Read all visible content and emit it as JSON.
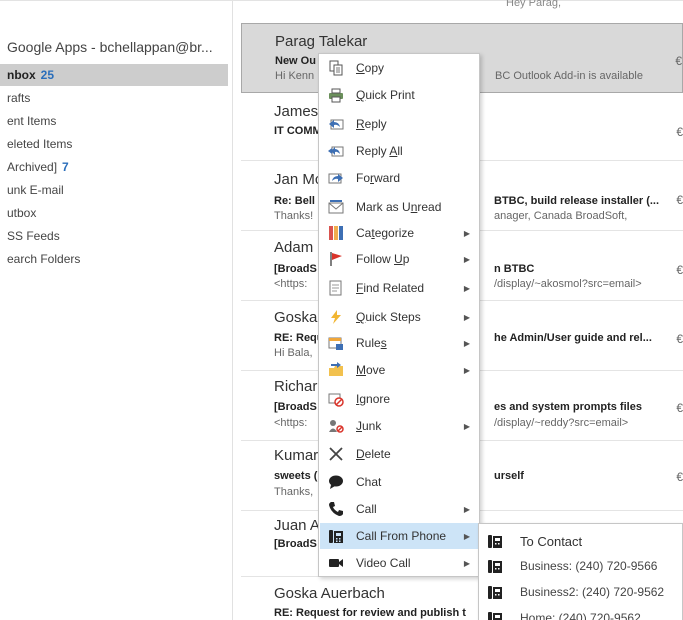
{
  "folders": {
    "account": "Google Apps - bchellappan@br...",
    "items": [
      {
        "label": "nbox",
        "count": "25",
        "selected": true
      },
      {
        "label": "rafts",
        "count": ""
      },
      {
        "label": "ent Items",
        "count": ""
      },
      {
        "label": "eleted Items",
        "count": ""
      },
      {
        "label": "Archived]",
        "count": "7"
      },
      {
        "label": "unk E-mail",
        "count": ""
      },
      {
        "label": "utbox",
        "count": ""
      },
      {
        "label": "SS Feeds",
        "count": ""
      },
      {
        "label": "earch Folders",
        "count": ""
      }
    ]
  },
  "messages": {
    "top_fragment": "Hey Parag,",
    "items": [
      {
        "sender": "Parag Talekar",
        "subject": "New Ou",
        "preview": "Hi Kenn",
        "right_subject": "",
        "right_preview": "BC Outlook Add-in is available",
        "marker": "€"
      },
      {
        "sender": "James",
        "subject": "IT COMM",
        "preview": "",
        "right_subject": "",
        "right_preview": "",
        "marker": "€"
      },
      {
        "sender": "Jan Mc",
        "subject": "Re: Bell",
        "preview": "Thanks!",
        "right_subject": "BTBC, build release installer (...",
        "right_preview": "anager, Canada BroadSoft,",
        "marker": "€"
      },
      {
        "sender": "Adam",
        "subject": "[BroadS",
        "preview": "<https:",
        "right_subject": "n BTBC",
        "right_preview": "/display/~akosmol?src=email>",
        "marker": "€"
      },
      {
        "sender": "Goska",
        "subject": "RE: Requ",
        "preview": "Hi Bala,",
        "right_subject": "he Admin/User guide and rel...",
        "right_preview": "",
        "marker": "€"
      },
      {
        "sender": "Richar",
        "subject": "[BroadS",
        "preview": "<https:",
        "right_subject": "es and system prompts files",
        "right_preview": "/display/~reddy?src=email>",
        "marker": "€"
      },
      {
        "sender": "Kumar",
        "subject": "sweets (",
        "preview": "Thanks,",
        "right_subject": "urself",
        "right_preview": "",
        "marker": "€"
      },
      {
        "sender": "Juan A",
        "subject": "[BroadS",
        "preview": "",
        "right_subject": "",
        "right_preview": "",
        "marker": "€"
      },
      {
        "sender": "Goska Auerbach",
        "subject": "RE: Request for review and publish t",
        "preview": "",
        "right_subject": "",
        "right_preview": "",
        "marker": "€"
      }
    ]
  },
  "context_menu": {
    "items": [
      {
        "pre": "",
        "u": "C",
        "post": "opy",
        "icon": "copy-icon",
        "arrow": ""
      },
      {
        "pre": "",
        "u": "Q",
        "post": "uick Print",
        "icon": "quick-print-icon",
        "arrow": ""
      },
      {
        "pre": "",
        "u": "R",
        "post": "eply",
        "icon": "reply-icon",
        "arrow": ""
      },
      {
        "pre": "Reply ",
        "u": "A",
        "post": "ll",
        "icon": "reply-all-icon",
        "arrow": ""
      },
      {
        "pre": "Fo",
        "u": "r",
        "post": "ward",
        "icon": "forward-icon",
        "arrow": ""
      },
      {
        "pre": "Mark as U",
        "u": "n",
        "post": "read",
        "icon": "mark-unread-icon",
        "arrow": ""
      },
      {
        "pre": "Ca",
        "u": "t",
        "post": "egorize",
        "icon": "categorize-icon",
        "arrow": "▶"
      },
      {
        "pre": "Follow ",
        "u": "U",
        "post": "p",
        "icon": "flag-icon",
        "arrow": "▶"
      },
      {
        "pre": "",
        "u": "F",
        "post": "ind Related",
        "icon": "find-related-icon",
        "arrow": "▶"
      },
      {
        "pre": "",
        "u": "Q",
        "post": "uick Steps",
        "icon": "quick-steps-icon",
        "arrow": "▶"
      },
      {
        "pre": "Rule",
        "u": "s",
        "post": "",
        "icon": "rules-icon",
        "arrow": "▶"
      },
      {
        "pre": "",
        "u": "M",
        "post": "ove",
        "icon": "move-icon",
        "arrow": "▶"
      },
      {
        "pre": "",
        "u": "I",
        "post": "gnore",
        "icon": "ignore-icon",
        "arrow": ""
      },
      {
        "pre": "",
        "u": "J",
        "post": "unk",
        "icon": "junk-icon",
        "arrow": "▶"
      },
      {
        "pre": "",
        "u": "D",
        "post": "elete",
        "icon": "delete-icon",
        "arrow": ""
      },
      {
        "pre": "Chat",
        "u": "",
        "post": "",
        "icon": "chat-icon",
        "arrow": ""
      },
      {
        "pre": "Call",
        "u": "",
        "post": "",
        "icon": "phone-icon",
        "arrow": "▶"
      },
      {
        "pre": "Call From Phone",
        "u": "",
        "post": "",
        "icon": "desk-phone-icon",
        "arrow": "▶",
        "highlight": true
      },
      {
        "pre": "Video Call",
        "u": "",
        "post": "",
        "icon": "video-camera-icon",
        "arrow": "▶"
      }
    ]
  },
  "submenu": {
    "items": [
      {
        "label": "To Contact",
        "header": true
      },
      {
        "label": "Business: (240) 720-9566"
      },
      {
        "label": "Business2: (240) 720-9562"
      },
      {
        "label": "Home: (240) 720-9562"
      }
    ]
  }
}
